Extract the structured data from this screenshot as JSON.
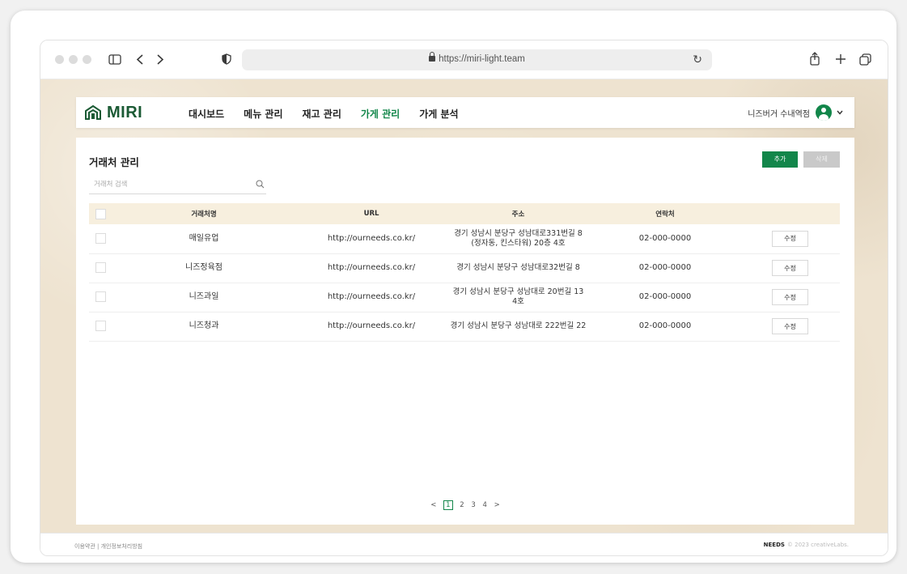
{
  "browser": {
    "url": "https://miri-light.team"
  },
  "nav": {
    "logo": "MIRI",
    "menu": [
      {
        "label": "대시보드",
        "active": false
      },
      {
        "label": "메뉴 관리",
        "active": false
      },
      {
        "label": "재고 관리",
        "active": false
      },
      {
        "label": "가게 관리",
        "active": true
      },
      {
        "label": "가게 분석",
        "active": false
      }
    ],
    "user_name": "니즈버거 수내역점"
  },
  "page": {
    "title": "거래처 관리",
    "add_label": "추가",
    "delete_label": "삭제",
    "search_placeholder": "거래처 검색"
  },
  "table": {
    "headers": [
      "거래처명",
      "URL",
      "주소",
      "연락처"
    ],
    "edit_label": "수정",
    "rows": [
      {
        "name": "매일유업",
        "url": "http://ourneeds.co.kr/",
        "addr1": "경기 성남시 분당구 성남대로331번길 8",
        "addr2": "(정자동, 킨스타워) 20층 4호",
        "phone": "02-000-0000"
      },
      {
        "name": "니즈정육점",
        "url": "http://ourneeds.co.kr/",
        "addr1": "경기 성남시 분당구 성남대로32번길 8",
        "addr2": "",
        "phone": "02-000-0000"
      },
      {
        "name": "니즈과일",
        "url": "http://ourneeds.co.kr/",
        "addr1": "경기 성남시 분당구 성남대로 20번길 13",
        "addr2": "4호",
        "phone": "02-000-0000"
      },
      {
        "name": "니즈청과",
        "url": "http://ourneeds.co.kr/",
        "addr1": "경기 성남시 분당구 성남대로 222번길 22",
        "addr2": "",
        "phone": "02-000-0000"
      }
    ]
  },
  "pagination": {
    "prev": "<",
    "pages": [
      "1",
      "2",
      "3",
      "4"
    ],
    "current": "1",
    "next": ">"
  },
  "footer": {
    "links": "이용약관 | 개인정보처리방침",
    "brand": "NEEDS",
    "copyright": "© 2023 creativeLabs."
  },
  "colors": {
    "accent": "#12864a",
    "brand": "#1b5a34",
    "header_bg": "#f7efde"
  }
}
